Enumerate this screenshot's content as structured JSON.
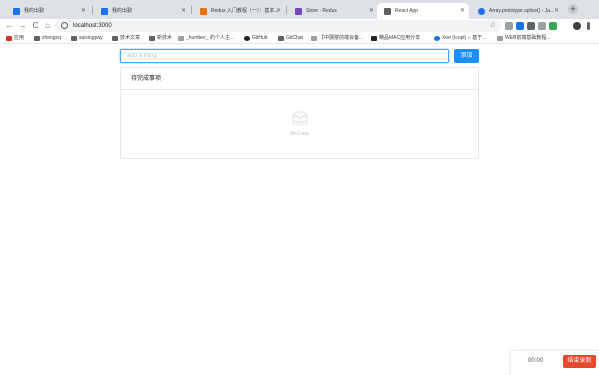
{
  "browser": {
    "tabs": [
      {
        "title": "我的出勤",
        "favicon_color": "#1a73e8"
      },
      {
        "title": "我的出勤",
        "favicon_color": "#1a73e8"
      },
      {
        "title": "Redux 入门教程（一）：基本...",
        "favicon_color": "#e8710a"
      },
      {
        "title": "Store · Redux",
        "favicon_color": "#764abc"
      },
      {
        "title": "React App",
        "favicon_color": "#5f6368"
      },
      {
        "title": "Array.prototype.splice() - Ja...",
        "favicon_color": "#1a73e8"
      }
    ],
    "active_tab_index": 4,
    "new_tab_label": "+",
    "url": "localhost:3000",
    "nav": {
      "back": "←",
      "forward": "→",
      "reload": "C",
      "home": "⌂",
      "star": "☆"
    },
    "bookmarks": [
      {
        "label": "应用",
        "color": "#d93025"
      },
      {
        "label": "zhengxq",
        "color": "#5f6368"
      },
      {
        "label": "suixingpay",
        "color": "#5f6368"
      },
      {
        "label": "技术文章",
        "color": "#5f6368"
      },
      {
        "label": "新技术",
        "color": "#5f6368"
      },
      {
        "label": "_humber_ 的个人主...",
        "color": "#9aa0a6"
      },
      {
        "label": "GitHub",
        "color": "#202124"
      },
      {
        "label": "GitChat",
        "color": "#5f6368"
      },
      {
        "label": "【中展楼前端会备...",
        "color": "#9aa0a6"
      },
      {
        "label": "精品MAC应用分享",
        "color": "#202124"
      },
      {
        "label": "Xee (Icopi) -- 基于...",
        "color": "#1a73e8"
      },
      {
        "label": "WEB前端基础教程...",
        "color": "#9aa0a6"
      }
    ]
  },
  "app": {
    "input_value": "",
    "input_placeholder": "add a thing",
    "add_button": "添加",
    "list_header": "待完成事项",
    "empty_text": "No Data"
  },
  "recorder": {
    "time": "00:00",
    "stop_button": "结束录制"
  }
}
